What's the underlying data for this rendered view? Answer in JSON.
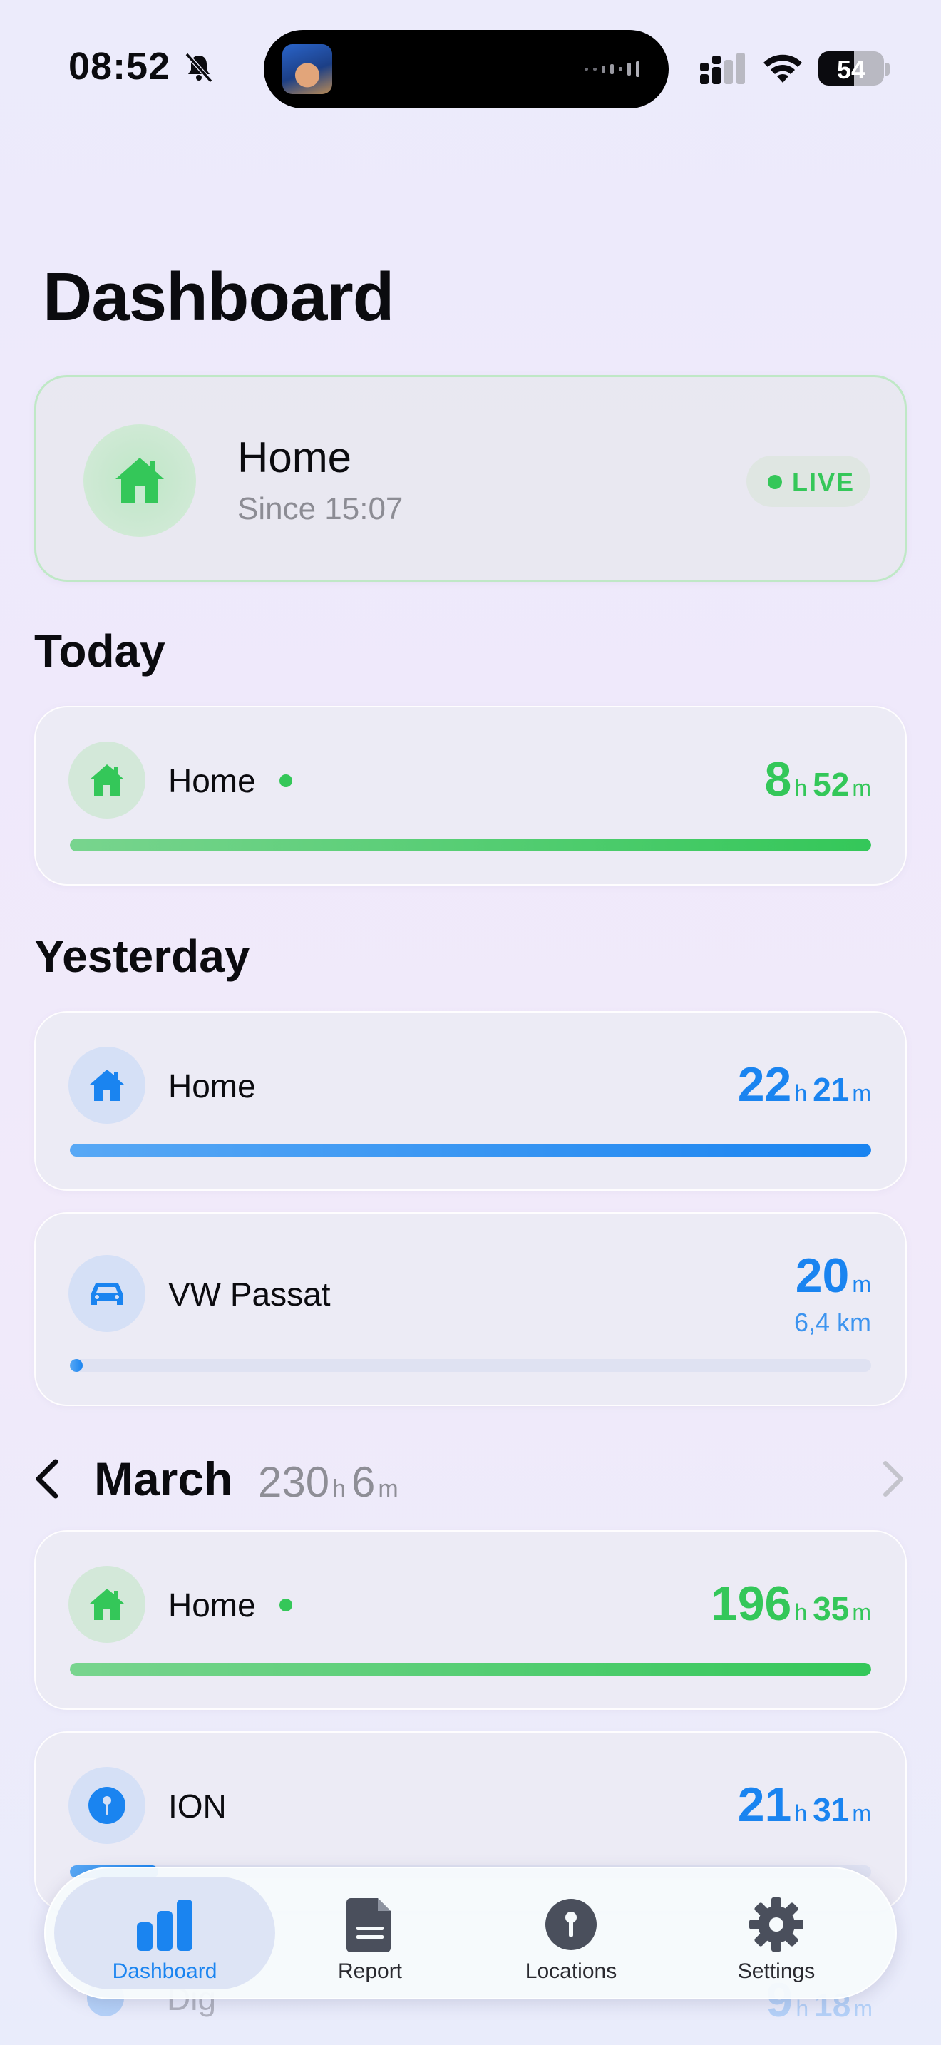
{
  "status_bar": {
    "time": "08:52",
    "battery": "54",
    "icons": [
      "bell-slash-icon",
      "cellular-signal-icon",
      "wifi-icon",
      "battery-icon"
    ]
  },
  "page": {
    "title": "Dashboard"
  },
  "live": {
    "title": "Home",
    "subtitle": "Since 15:07",
    "badge": "LIVE",
    "icon": "house-icon",
    "accent": "#34c759"
  },
  "sections": {
    "today": "Today",
    "yesterday": "Yesterday"
  },
  "today": [
    {
      "label": "Home",
      "hours": "8",
      "minutes": "52",
      "h_unit": "h",
      "m_unit": "m",
      "progress": 1.0,
      "active": true
    }
  ],
  "yesterday": [
    {
      "label": "Home",
      "hours": "22",
      "minutes": "21",
      "h_unit": "h",
      "m_unit": "m",
      "progress": 1.0
    },
    {
      "label": "VW Passat",
      "minutes": "20",
      "m_unit": "m",
      "distance": "6,4 km",
      "progress": 0.01,
      "icon": "car-icon"
    }
  ],
  "month": {
    "name": "March",
    "total_hours": "230",
    "total_minutes": "6",
    "h_unit": "h",
    "m_unit": "m",
    "rows": [
      {
        "label": "Home",
        "hours": "196",
        "minutes": "35",
        "h_unit": "h",
        "m_unit": "m",
        "progress": 1.0,
        "active": true
      },
      {
        "label": "ION",
        "hours": "21",
        "minutes": "31",
        "h_unit": "h",
        "m_unit": "m",
        "progress": 0.11,
        "icon": "pin-icon"
      },
      {
        "label": "Dig",
        "hours": "9",
        "minutes": "18",
        "h_unit": "h",
        "m_unit": "m"
      }
    ]
  },
  "colors": {
    "green": "#34c759",
    "blue": "#1a84f0"
  },
  "tabs": [
    {
      "label": "Dashboard",
      "icon": "chart-bar-icon",
      "active": true
    },
    {
      "label": "Report",
      "icon": "document-icon",
      "active": false
    },
    {
      "label": "Locations",
      "icon": "pin-icon",
      "active": false
    },
    {
      "label": "Settings",
      "icon": "gear-icon",
      "active": false
    }
  ]
}
